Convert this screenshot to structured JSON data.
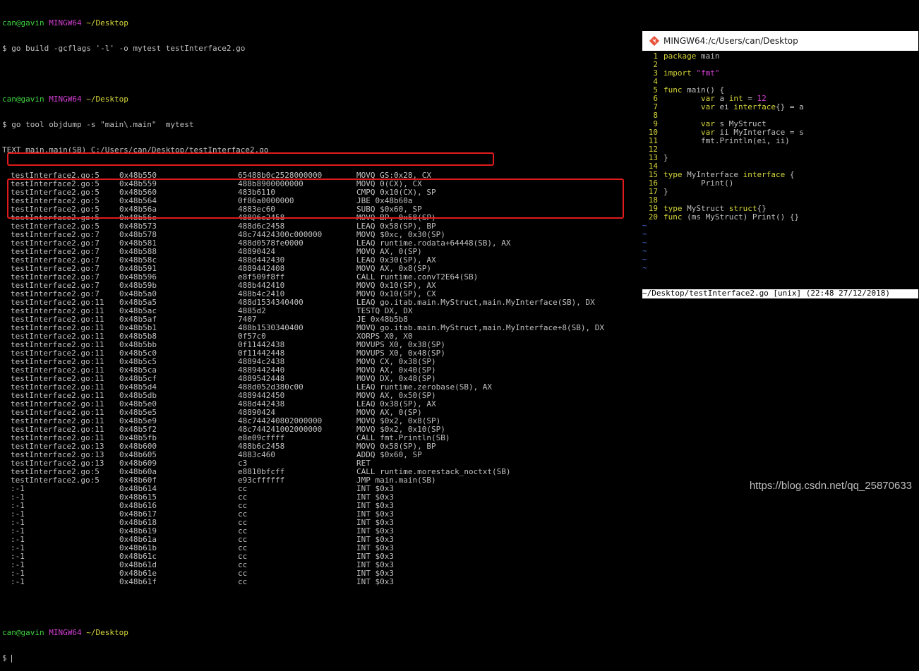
{
  "terminal": {
    "prompt_user": "can@gavin",
    "prompt_host": "MINGW64",
    "prompt_path": "~/Desktop",
    "cmd1": "$ go build -gcflags '-l' -o mytest testInterface2.go",
    "cmd2": "$ go tool objdump -s \"main\\.main\"  mytest",
    "text_header": "TEXT main.main(SB) C:/Users/can/Desktop/testInterface2.go",
    "rows": [
      [
        "testInterface2.go:5",
        "0x48b550",
        "65488b0c2528000000",
        "MOVQ GS:0x28, CX"
      ],
      [
        "testInterface2.go:5",
        "0x48b559",
        "488b8900000000",
        "MOVQ 0(CX), CX"
      ],
      [
        "testInterface2.go:5",
        "0x48b560",
        "483b6110",
        "CMPQ 0x10(CX), SP"
      ],
      [
        "testInterface2.go:5",
        "0x48b564",
        "0f86a0000000",
        "JBE 0x48b60a"
      ],
      [
        "testInterface2.go:5",
        "0x48b56a",
        "4883ec60",
        "SUBQ $0x60, SP"
      ],
      [
        "testInterface2.go:5",
        "0x48b56e",
        "48896c2458",
        "MOVQ BP, 0x58(SP)"
      ],
      [
        "testInterface2.go:5",
        "0x48b573",
        "488d6c2458",
        "LEAQ 0x58(SP), BP"
      ],
      [
        "testInterface2.go:7",
        "0x48b578",
        "48c74424300c000000",
        "MOVQ $0xc, 0x30(SP)"
      ],
      [
        "testInterface2.go:7",
        "0x48b581",
        "488d0578fe0000",
        "LEAQ runtime.rodata+64448(SB), AX"
      ],
      [
        "testInterface2.go:7",
        "0x48b588",
        "48890424",
        "MOVQ AX, 0(SP)"
      ],
      [
        "testInterface2.go:7",
        "0x48b58c",
        "488d442430",
        "LEAQ 0x30(SP), AX"
      ],
      [
        "testInterface2.go:7",
        "0x48b591",
        "4889442408",
        "MOVQ AX, 0x8(SP)"
      ],
      [
        "testInterface2.go:7",
        "0x48b596",
        "e8f509f8ff",
        "CALL runtime.convT2E64(SB)"
      ],
      [
        "testInterface2.go:7",
        "0x48b59b",
        "488b442410",
        "MOVQ 0x10(SP), AX"
      ],
      [
        "testInterface2.go:7",
        "0x48b5a0",
        "488b4c2410",
        "MOVQ 0x10(SP), CX"
      ],
      [
        "testInterface2.go:11",
        "0x48b5a5",
        "488d1534340400",
        "LEAQ go.itab.main.MyStruct,main.MyInterface(SB), DX"
      ],
      [
        "testInterface2.go:11",
        "0x48b5ac",
        "4885d2",
        "TESTQ DX, DX"
      ],
      [
        "testInterface2.go:11",
        "0x48b5af",
        "7407",
        "JE 0x48b5b8"
      ],
      [
        "testInterface2.go:11",
        "0x48b5b1",
        "488b1530340400",
        "MOVQ go.itab.main.MyStruct,main.MyInterface+8(SB), DX"
      ],
      [
        "testInterface2.go:11",
        "0x48b5b8",
        "0f57c0",
        "XORPS X0, X0"
      ],
      [
        "testInterface2.go:11",
        "0x48b5bb",
        "0f11442438",
        "MOVUPS X0, 0x38(SP)"
      ],
      [
        "testInterface2.go:11",
        "0x48b5c0",
        "0f11442448",
        "MOVUPS X0, 0x48(SP)"
      ],
      [
        "testInterface2.go:11",
        "0x48b5c5",
        "48894c2438",
        "MOVQ CX, 0x38(SP)"
      ],
      [
        "testInterface2.go:11",
        "0x48b5ca",
        "4889442440",
        "MOVQ AX, 0x40(SP)"
      ],
      [
        "testInterface2.go:11",
        "0x48b5cf",
        "4889542448",
        "MOVQ DX, 0x48(SP)"
      ],
      [
        "testInterface2.go:11",
        "0x48b5d4",
        "488d052d380c00",
        "LEAQ runtime.zerobase(SB), AX"
      ],
      [
        "testInterface2.go:11",
        "0x48b5db",
        "4889442450",
        "MOVQ AX, 0x50(SP)"
      ],
      [
        "testInterface2.go:11",
        "0x48b5e0",
        "488d442438",
        "LEAQ 0x38(SP), AX"
      ],
      [
        "testInterface2.go:11",
        "0x48b5e5",
        "48890424",
        "MOVQ AX, 0(SP)"
      ],
      [
        "testInterface2.go:11",
        "0x48b5e9",
        "48c744240802000000",
        "MOVQ $0x2, 0x8(SP)"
      ],
      [
        "testInterface2.go:11",
        "0x48b5f2",
        "48c744241002000000",
        "MOVQ $0x2, 0x10(SP)"
      ],
      [
        "testInterface2.go:11",
        "0x48b5fb",
        "e8e09cffff",
        "CALL fmt.Println(SB)"
      ],
      [
        "testInterface2.go:13",
        "0x48b600",
        "488b6c2458",
        "MOVQ 0x58(SP), BP"
      ],
      [
        "testInterface2.go:13",
        "0x48b605",
        "4883c460",
        "ADDQ $0x60, SP"
      ],
      [
        "testInterface2.go:13",
        "0x48b609",
        "c3",
        "RET"
      ],
      [
        "testInterface2.go:5",
        "0x48b60a",
        "e8810bfcff",
        "CALL runtime.morestack_noctxt(SB)"
      ],
      [
        "testInterface2.go:5",
        "0x48b60f",
        "e93cffffff",
        "JMP main.main(SB)"
      ],
      [
        ":-1",
        "0x48b614",
        "cc",
        "INT $0x3"
      ],
      [
        ":-1",
        "0x48b615",
        "cc",
        "INT $0x3"
      ],
      [
        ":-1",
        "0x48b616",
        "cc",
        "INT $0x3"
      ],
      [
        ":-1",
        "0x48b617",
        "cc",
        "INT $0x3"
      ],
      [
        ":-1",
        "0x48b618",
        "cc",
        "INT $0x3"
      ],
      [
        ":-1",
        "0x48b619",
        "cc",
        "INT $0x3"
      ],
      [
        ":-1",
        "0x48b61a",
        "cc",
        "INT $0x3"
      ],
      [
        ":-1",
        "0x48b61b",
        "cc",
        "INT $0x3"
      ],
      [
        ":-1",
        "0x48b61c",
        "cc",
        "INT $0x3"
      ],
      [
        ":-1",
        "0x48b61d",
        "cc",
        "INT $0x3"
      ],
      [
        ":-1",
        "0x48b61e",
        "cc",
        "INT $0x3"
      ],
      [
        ":-1",
        "0x48b61f",
        "cc",
        "INT $0x3"
      ]
    ],
    "final_prompt": "$"
  },
  "editor_window": {
    "title": "MINGW64:/c/Users/can/Desktop",
    "icon": "git-bash-icon",
    "code_lines": [
      {
        "n": "1",
        "html": "<span class=\"kw\">package</span> main"
      },
      {
        "n": "2",
        "html": ""
      },
      {
        "n": "3",
        "html": "<span class=\"kw\">import</span> <span class=\"str\">\"fmt\"</span>"
      },
      {
        "n": "4",
        "html": ""
      },
      {
        "n": "5",
        "html": "<span class=\"kw\">func</span> main() {"
      },
      {
        "n": "6",
        "html": "        <span class=\"kw\">var</span> a <span class=\"ty\">int</span> = <span class=\"num\">12</span>"
      },
      {
        "n": "7",
        "html": "        <span class=\"kw\">var</span> ei <span class=\"ty\">interface</span>{} = a"
      },
      {
        "n": "8",
        "html": ""
      },
      {
        "n": "9",
        "html": "        <span class=\"kw\">var</span> s MyStruct"
      },
      {
        "n": "10",
        "html": "        <span class=\"kw\">var</span> ii MyInterface = s"
      },
      {
        "n": "11",
        "html": "        fmt.Println(ei, ii)"
      },
      {
        "n": "12",
        "html": ""
      },
      {
        "n": "13",
        "html": "}"
      },
      {
        "n": "14",
        "html": ""
      },
      {
        "n": "15",
        "html": "<span class=\"kw\">type</span> MyInterface <span class=\"kw\">interface</span> {"
      },
      {
        "n": "16",
        "html": "        Print()"
      },
      {
        "n": "17",
        "html": "}"
      },
      {
        "n": "18",
        "html": ""
      },
      {
        "n": "19",
        "html": "<span class=\"kw\">type</span> MyStruct <span class=\"kw\">struct</span>{}"
      },
      {
        "n": "20",
        "html": "<span class=\"kw\">func</span> (ms MyStruct) Print() {}"
      }
    ],
    "tildes": 6,
    "status": "~/Desktop/testInterface2.go [unix] (22:48 27/12/2018)"
  },
  "watermark": "https://blog.csdn.net/qq_25870633"
}
